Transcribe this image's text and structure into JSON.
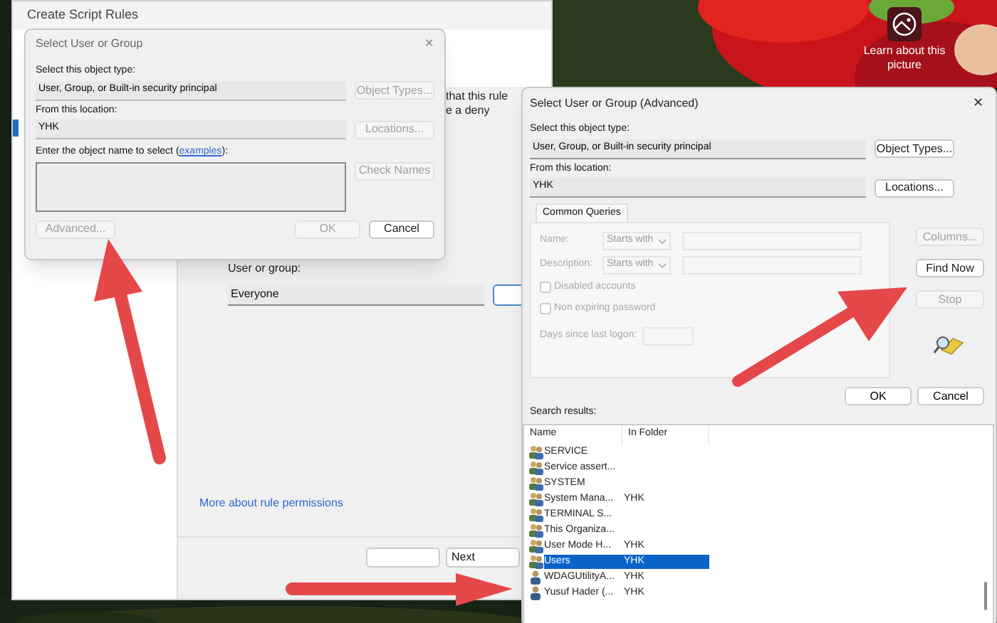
{
  "desktop": {
    "learn_label": "Learn about this picture"
  },
  "main_window": {
    "title": "Create Script Rules",
    "description_lines": [
      "that this rule",
      "e a deny"
    ],
    "user_group_label": "User or group:",
    "user_group_value": "Everyone",
    "link": "More about rule permissions",
    "next_button": "Next"
  },
  "select_dialog": {
    "title": "Select User or Group",
    "close": "✕",
    "object_type_label": "Select this object type:",
    "object_type_value": "User, Group, or Built-in security principal",
    "object_types_button": {
      "label": "Object Types...",
      "disabled": true
    },
    "location_label": "From this location:",
    "location_value": "YHK",
    "locations_button": {
      "label": "Locations...",
      "disabled": true
    },
    "name_label_before": "Enter the object name to select (",
    "name_label_link": "examples",
    "name_label_after": "):",
    "check_names_button": {
      "label": "Check Names",
      "disabled": true
    },
    "advanced_button": {
      "label": "Advanced...",
      "disabled": true
    },
    "ok_button": {
      "label": "OK",
      "disabled": true
    },
    "cancel_button": {
      "label": "Cancel",
      "disabled": false
    }
  },
  "advanced_dialog": {
    "title": "Select User or Group (Advanced)",
    "close": "✕",
    "object_type_label": "Select this object type:",
    "object_type_value": "User, Group, or Built-in security principal",
    "object_types_button": {
      "label": "Object Types...",
      "disabled": false
    },
    "location_label": "From this location:",
    "location_value": "YHK",
    "locations_button": {
      "label": "Locations...",
      "disabled": false
    },
    "tabs": [
      {
        "label": "Common Queries",
        "selected": true
      }
    ],
    "queries": [
      {
        "label": "Name:",
        "mode": "Starts with"
      },
      {
        "label": "Description:",
        "mode": "Starts with"
      }
    ],
    "checkboxes": [
      {
        "label": "Disabled accounts",
        "checked": false
      },
      {
        "label": "Non expiring password",
        "checked": false
      }
    ],
    "days_label": "Days since last logon:",
    "side_buttons": [
      {
        "label": "Columns...",
        "disabled": true
      },
      {
        "label": "Find Now",
        "disabled": false
      },
      {
        "label": "Stop",
        "disabled": true
      }
    ],
    "ok_button": "OK",
    "cancel_button": "Cancel",
    "results_label": "Search results:",
    "results": {
      "columns": [
        "Name",
        "In Folder"
      ],
      "rows": [
        {
          "name": "SERVICE",
          "folder": "",
          "kind": "group",
          "selected": false
        },
        {
          "name": "Service assert...",
          "folder": "",
          "kind": "group",
          "selected": false
        },
        {
          "name": "SYSTEM",
          "folder": "",
          "kind": "group",
          "selected": false
        },
        {
          "name": "System Mana...",
          "folder": "YHK",
          "kind": "group",
          "selected": false
        },
        {
          "name": "TERMINAL S...",
          "folder": "",
          "kind": "group",
          "selected": false
        },
        {
          "name": "This Organiza...",
          "folder": "",
          "kind": "group",
          "selected": false
        },
        {
          "name": "User Mode H...",
          "folder": "YHK",
          "kind": "group",
          "selected": false
        },
        {
          "name": "Users",
          "folder": "YHK",
          "kind": "group",
          "selected": true
        },
        {
          "name": "WDAGUtilityA...",
          "folder": "YHK",
          "kind": "user",
          "selected": false
        },
        {
          "name": "Yusuf Hader (...",
          "folder": "YHK",
          "kind": "user",
          "selected": false
        }
      ]
    }
  }
}
